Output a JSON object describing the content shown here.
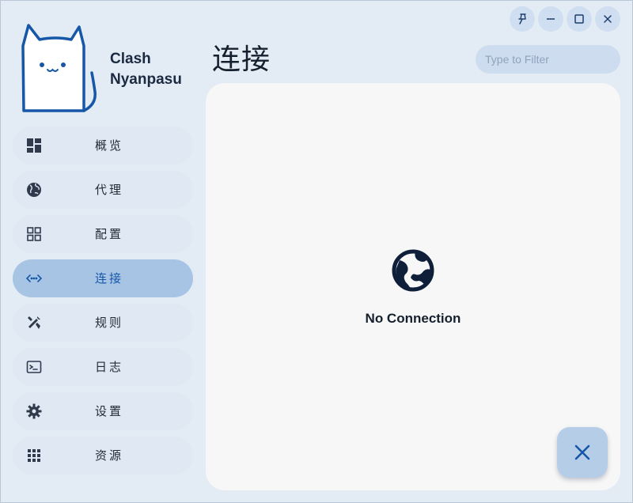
{
  "app": {
    "name_line1": "Clash",
    "name_line2": "Nyanpasu"
  },
  "window_controls": [
    {
      "name": "pin-icon"
    },
    {
      "name": "minimize-icon"
    },
    {
      "name": "maximize-icon"
    },
    {
      "name": "close-icon"
    }
  ],
  "sidebar": {
    "items": [
      {
        "label": "概览",
        "icon": "dashboard-icon",
        "active": false
      },
      {
        "label": "代理",
        "icon": "globe-icon",
        "active": false
      },
      {
        "label": "配置",
        "icon": "grid-icon",
        "active": false
      },
      {
        "label": "连接",
        "icon": "connection-icon",
        "active": true
      },
      {
        "label": "规则",
        "icon": "tools-icon",
        "active": false
      },
      {
        "label": "日志",
        "icon": "terminal-icon",
        "active": false
      },
      {
        "label": "设置",
        "icon": "gear-icon",
        "active": false
      },
      {
        "label": "资源",
        "icon": "apps-icon",
        "active": false
      }
    ]
  },
  "header": {
    "title": "连接",
    "filter_placeholder": "Type to Filter"
  },
  "main": {
    "empty_text": "No Connection",
    "empty_icon": "globe-icon"
  },
  "fab": {
    "icon": "close-icon"
  },
  "colors": {
    "background": "#e3ebf5",
    "active_item": "#a7c4e4",
    "accent": "#1757a8",
    "panel": "#f7f7f7"
  }
}
